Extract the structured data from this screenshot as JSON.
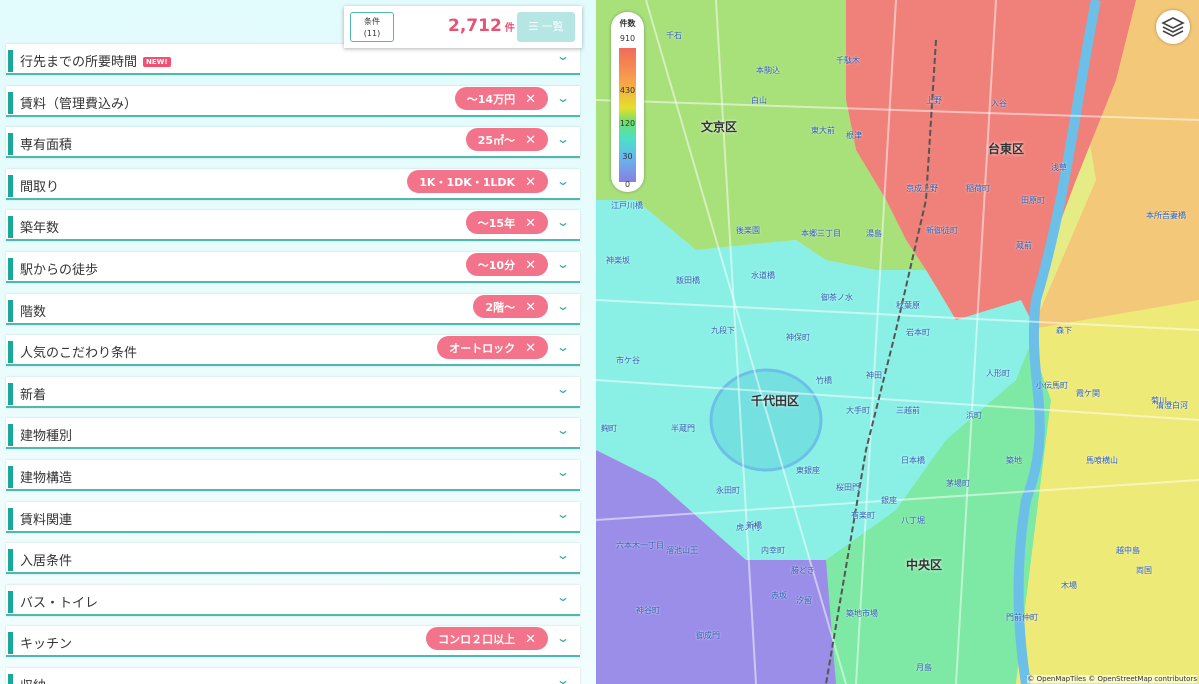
{
  "summary": {
    "conditions_label": "条件",
    "conditions_count": "(11)",
    "count": "2,712",
    "count_unit": "件",
    "list_label": "☰ 一覧"
  },
  "filters": [
    {
      "label": "行先までの所要時間",
      "badge": "NEW!"
    },
    {
      "label": "賃料（管理費込み）",
      "chip": "〜14万円"
    },
    {
      "label": "専有面積",
      "chip": "25㎡〜"
    },
    {
      "label": "間取り",
      "chip": "1K・1DK・1LDK"
    },
    {
      "label": "築年数",
      "chip": "〜15年"
    },
    {
      "label": "駅からの徒歩",
      "chip": "〜10分"
    },
    {
      "label": "階数",
      "chip": "2階〜"
    },
    {
      "label": "人気のこだわり条件",
      "chip": "オートロック"
    },
    {
      "label": "新着"
    },
    {
      "label": "建物種別"
    },
    {
      "label": "建物構造"
    },
    {
      "label": "賃料関連"
    },
    {
      "label": "入居条件"
    },
    {
      "label": "バス・トイレ"
    },
    {
      "label": "キッチン",
      "chip": "コンロ２口以上"
    },
    {
      "label": "収納"
    }
  ],
  "chip_close": "✕",
  "chevron": "⌄",
  "legend": {
    "title": "件数",
    "ticks": [
      "910",
      "430",
      "120",
      "30",
      "0"
    ],
    "colors": [
      "#f06a5c",
      "#f8a24a",
      "#e4e02c",
      "#6fe06b",
      "#4de0c8",
      "#67b6ec",
      "#8a7ee0"
    ]
  },
  "map": {
    "districts": [
      "文京区",
      "台東区",
      "千代田区",
      "中央区"
    ],
    "stations": [
      "千石",
      "本駒込",
      "千駄木",
      "白山",
      "東大前",
      "根津",
      "上野",
      "入谷",
      "京成上野",
      "稲荷町",
      "田原町",
      "浅草",
      "後楽園",
      "本郷三丁目",
      "湯島",
      "新御徒町",
      "蔵前",
      "水道橋",
      "御茶ノ水",
      "秋葉原",
      "岩本町",
      "九段下",
      "神保町",
      "竹橋",
      "大手町",
      "神田",
      "三越前",
      "日本橋",
      "茅場町",
      "八丁堀",
      "有楽町",
      "銀座",
      "東銀座",
      "築地",
      "桜田門",
      "霞ケ関",
      "虎ノ門",
      "新橋",
      "赤坂",
      "六本木一丁目",
      "神谷町",
      "御成門",
      "勝どき",
      "月島",
      "門前仲町",
      "越中島",
      "木場",
      "両国",
      "森下",
      "清澄白河",
      "馬喰横山",
      "人形町",
      "浜町",
      "小伝馬町",
      "市ケ谷",
      "飯田橋",
      "半蔵門",
      "麹町",
      "永田町",
      "溜池山王",
      "内幸町",
      "汐留",
      "築地市場",
      "本所吾妻橋",
      "菊川",
      "江戸川橋",
      "神楽坂"
    ],
    "attribution": "© OpenMapTiles © OpenStreetMap contributors"
  }
}
